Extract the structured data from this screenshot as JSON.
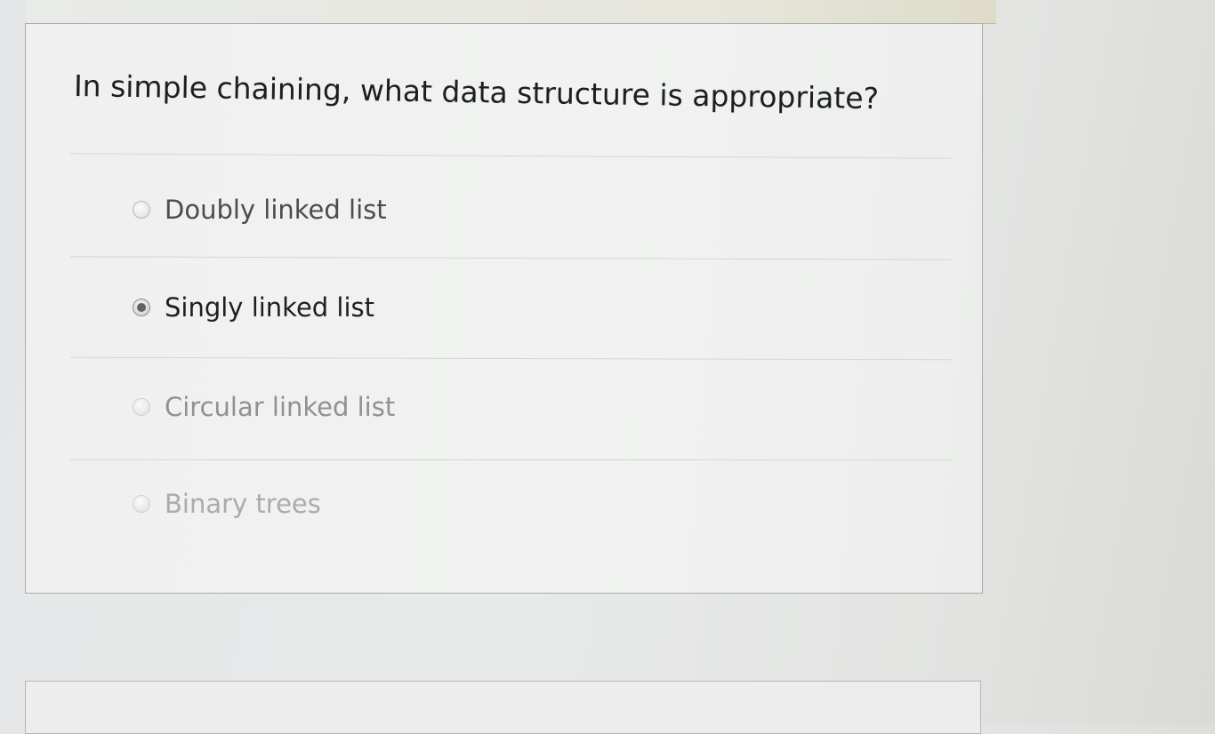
{
  "question": {
    "text": "In simple chaining, what data structure is appropriate?"
  },
  "options": [
    {
      "label": "Doubly linked list",
      "selected": false
    },
    {
      "label": "Singly linked list",
      "selected": true
    },
    {
      "label": "Circular linked list",
      "selected": false
    },
    {
      "label": "Binary trees",
      "selected": false
    }
  ]
}
